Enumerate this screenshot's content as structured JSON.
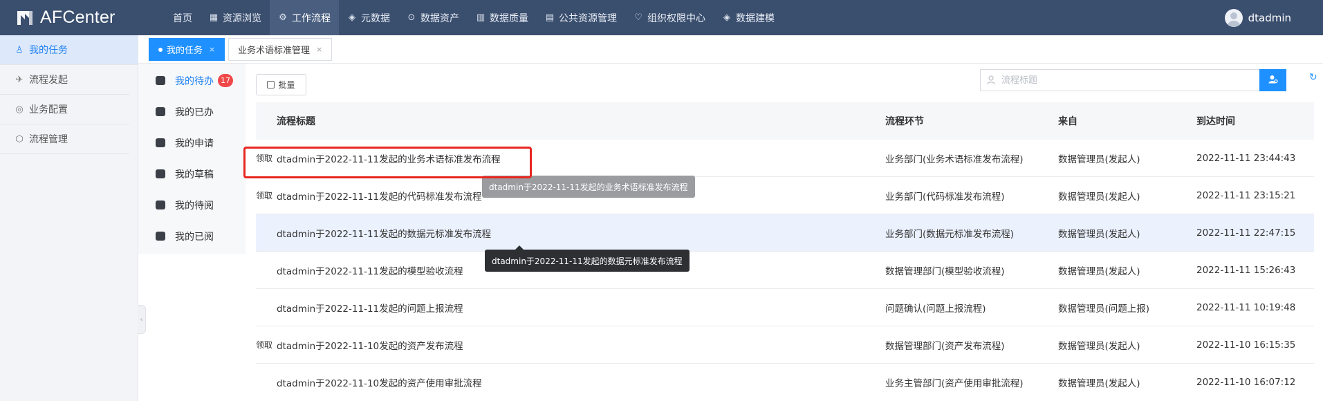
{
  "app": {
    "name": "AFCenter"
  },
  "nav": [
    {
      "label": "首页",
      "icon": "home-icon",
      "glyph": ""
    },
    {
      "label": "资源浏览",
      "icon": "grid-icon",
      "glyph": "▦"
    },
    {
      "label": "工作流程",
      "icon": "workflow-icon",
      "glyph": "⚙"
    },
    {
      "label": "元数据",
      "icon": "layers-icon",
      "glyph": "◈"
    },
    {
      "label": "数据资产",
      "icon": "asset-icon",
      "glyph": "⊙"
    },
    {
      "label": "数据质量",
      "icon": "chart-icon",
      "glyph": "▥"
    },
    {
      "label": "公共资源管理",
      "icon": "document-icon",
      "glyph": "▤"
    },
    {
      "label": "组织权限中心",
      "icon": "shield-icon",
      "glyph": "♡"
    },
    {
      "label": "数据建模",
      "icon": "model-icon",
      "glyph": "◈"
    }
  ],
  "user": {
    "name": "dtadmin"
  },
  "sidebar": [
    {
      "label": "我的任务",
      "icon": "user-icon",
      "glyph": "♙"
    },
    {
      "label": "流程发起",
      "icon": "send-icon",
      "glyph": "✈"
    },
    {
      "label": "业务配置",
      "icon": "config-icon",
      "glyph": "◎"
    },
    {
      "label": "流程管理",
      "icon": "cube-icon",
      "glyph": "⬡"
    }
  ],
  "tabs": [
    {
      "label": "我的任务",
      "close": "×"
    },
    {
      "label": "业务术语标准管理",
      "close": "×"
    }
  ],
  "submenu": [
    {
      "label": "我的待办",
      "badge": "17"
    },
    {
      "label": "我的已办"
    },
    {
      "label": "我的申请"
    },
    {
      "label": "我的草稿"
    },
    {
      "label": "我的待阅"
    },
    {
      "label": "我的已阅"
    }
  ],
  "toolbar": {
    "batch_label": "批量",
    "search_placeholder": "流程标题"
  },
  "table": {
    "headers": [
      "流程标题",
      "流程环节",
      "来自",
      "到达时间"
    ],
    "rows": [
      {
        "claim": "领取",
        "title": "dtadmin于2022-11-11发起的业务术语标准发布流程",
        "stage": "业务部门(业务术语标准发布流程)",
        "from": "数据管理员(发起人)",
        "time": "2022-11-11 23:44:43"
      },
      {
        "claim": "领取",
        "title": "dtadmin于2022-11-11发起的代码标准发布流程",
        "stage": "业务部门(代码标准发布流程)",
        "from": "数据管理员(发起人)",
        "time": "2022-11-11 23:15:21"
      },
      {
        "claim": "",
        "title": "dtadmin于2022-11-11发起的数据元标准发布流程",
        "stage": "业务部门(数据元标准发布流程)",
        "from": "数据管理员(发起人)",
        "time": "2022-11-11 22:47:15"
      },
      {
        "claim": "",
        "title": "dtadmin于2022-11-11发起的模型验收流程",
        "stage": "数据管理部门(模型验收流程)",
        "from": "数据管理员(发起人)",
        "time": "2022-11-11 15:26:43"
      },
      {
        "claim": "",
        "title": "dtadmin于2022-11-11发起的问题上报流程",
        "stage": "问题确认(问题上报流程)",
        "from": "数据管理员(问题上报)",
        "time": "2022-11-11 10:19:48"
      },
      {
        "claim": "领取",
        "title": "dtadmin于2022-11-10发起的资产发布流程",
        "stage": "数据管理部门(资产发布流程)",
        "from": "数据管理员(发起人)",
        "time": "2022-11-10 16:15:35"
      },
      {
        "claim": "",
        "title": "dtadmin于2022-11-10发起的资产使用审批流程",
        "stage": "业务主管部门(资产使用审批流程)",
        "from": "数据管理员(发起人)",
        "time": "2022-11-10 16:07:12"
      }
    ]
  },
  "tooltips": {
    "row1": "dtadmin于2022-11-11发起的业务术语标准发布流程",
    "row3": "dtadmin于2022-11-11发起的数据元标准发布流程"
  }
}
